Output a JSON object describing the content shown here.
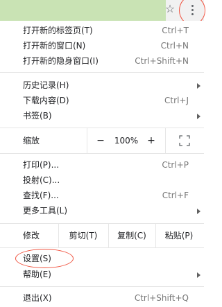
{
  "toolbar": {
    "star_icon": "star-icon",
    "menu_icon": "vertical-ellipsis-icon",
    "green_color": "#c9e3b4",
    "highlight_color": "#f0503c"
  },
  "menu": {
    "new_tab": {
      "label": "打开新的标签页(T)",
      "shortcut": "Ctrl+T"
    },
    "new_window": {
      "label": "打开新的窗口(N)",
      "shortcut": "Ctrl+N"
    },
    "incognito": {
      "label": "打开新的隐身窗口(I)",
      "shortcut": "Ctrl+Shift+N"
    },
    "history": {
      "label": "历史记录(H)"
    },
    "downloads": {
      "label": "下载内容(D)",
      "shortcut": "Ctrl+J"
    },
    "bookmarks": {
      "label": "书签(B)"
    },
    "zoom": {
      "label": "缩放",
      "minus": "−",
      "value": "100%",
      "plus": "+",
      "fullscreen_icon": "fullscreen-icon"
    },
    "print": {
      "label": "打印(P)...",
      "shortcut": "Ctrl+P"
    },
    "cast": {
      "label": "投射(C)..."
    },
    "find": {
      "label": "查找(F)...",
      "shortcut": "Ctrl+F"
    },
    "more_tools": {
      "label": "更多工具(L)"
    },
    "edit": {
      "label": "修改",
      "cut": "剪切(T)",
      "copy": "复制(C)",
      "paste": "粘贴(P)"
    },
    "settings": {
      "label": "设置(S)"
    },
    "help": {
      "label": "帮助(E)"
    },
    "exit": {
      "label": "退出(X)",
      "shortcut": "Ctrl+Shift+Q"
    }
  }
}
